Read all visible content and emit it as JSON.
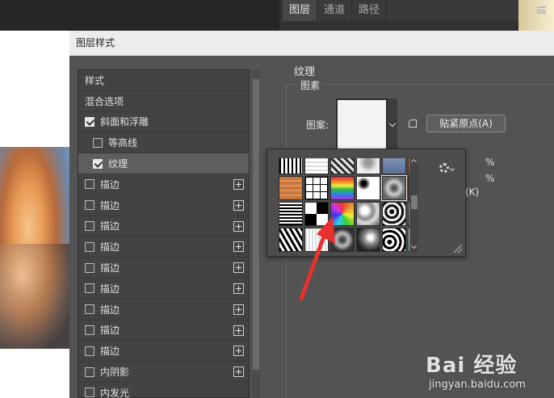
{
  "panel": {
    "tabs": [
      {
        "label": "图层"
      },
      {
        "label": "通道"
      },
      {
        "label": "路径"
      }
    ]
  },
  "dialog": {
    "title": "图层样式",
    "styles": [
      {
        "label": "样式",
        "checkbox": false,
        "checked": false,
        "add": false,
        "level": 0,
        "selected": false
      },
      {
        "label": "混合选项",
        "checkbox": false,
        "checked": false,
        "add": false,
        "level": 0,
        "selected": false
      },
      {
        "label": "斜面和浮雕",
        "checkbox": true,
        "checked": true,
        "add": false,
        "level": 1,
        "selected": false
      },
      {
        "label": "等高线",
        "checkbox": true,
        "checked": false,
        "add": false,
        "level": 2,
        "selected": false
      },
      {
        "label": "纹理",
        "checkbox": true,
        "checked": true,
        "add": false,
        "level": 2,
        "selected": true
      },
      {
        "label": "描边",
        "checkbox": true,
        "checked": false,
        "add": true,
        "level": 1,
        "selected": false
      },
      {
        "label": "描边",
        "checkbox": true,
        "checked": false,
        "add": true,
        "level": 1,
        "selected": false
      },
      {
        "label": "描边",
        "checkbox": true,
        "checked": false,
        "add": true,
        "level": 1,
        "selected": false
      },
      {
        "label": "描边",
        "checkbox": true,
        "checked": false,
        "add": true,
        "level": 1,
        "selected": false
      },
      {
        "label": "描边",
        "checkbox": true,
        "checked": false,
        "add": true,
        "level": 1,
        "selected": false
      },
      {
        "label": "描边",
        "checkbox": true,
        "checked": false,
        "add": true,
        "level": 1,
        "selected": false
      },
      {
        "label": "描边",
        "checkbox": true,
        "checked": false,
        "add": true,
        "level": 1,
        "selected": false
      },
      {
        "label": "描边",
        "checkbox": true,
        "checked": false,
        "add": true,
        "level": 1,
        "selected": false
      },
      {
        "label": "描边",
        "checkbox": true,
        "checked": false,
        "add": true,
        "level": 1,
        "selected": false
      },
      {
        "label": "内阴影",
        "checkbox": true,
        "checked": false,
        "add": true,
        "level": 1,
        "selected": false
      },
      {
        "label": "内发光",
        "checkbox": true,
        "checked": false,
        "add": false,
        "level": 1,
        "selected": false
      }
    ]
  },
  "texture": {
    "section_title": "纹理",
    "group_label": "图素",
    "pattern_label": "图案:",
    "snap_origin_label": "贴紧原点(A)",
    "percent_1": "%",
    "percent_2": "%",
    "invert_label": "(K)"
  },
  "picker": {
    "selected_index": 10
  },
  "watermark": {
    "logo": "Bai 经验",
    "url": "jingyan.baidu.com"
  },
  "colors": {
    "dialog_bg": "#535353",
    "list_bg": "#434343",
    "selected_row": "#5e5e5e",
    "annotation_arrow": "#e8312f"
  }
}
